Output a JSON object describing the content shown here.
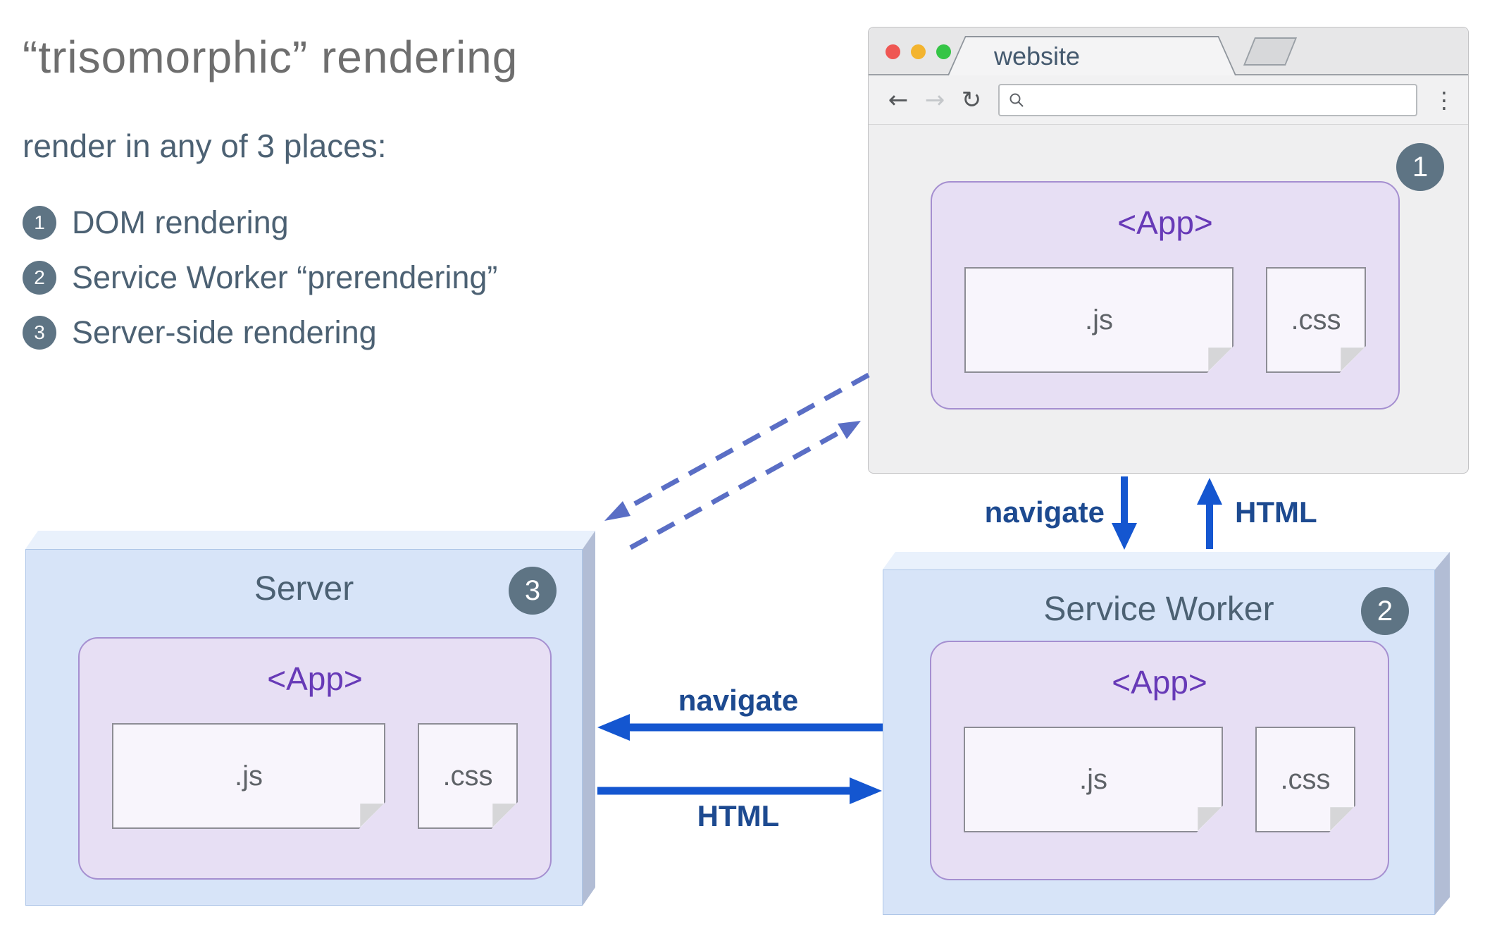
{
  "intro": {
    "title": "“trisomorphic” rendering",
    "subtitle": "render in any of 3 places:",
    "items": [
      {
        "num": "1",
        "label": "DOM rendering"
      },
      {
        "num": "2",
        "label": "Service Worker “prerendering”"
      },
      {
        "num": "3",
        "label": "Server-side rendering"
      }
    ]
  },
  "browser": {
    "tab_title": "website",
    "url_value": "",
    "badge": "1",
    "app": {
      "title": "<App>",
      "js_label": ".js",
      "css_label": ".css"
    }
  },
  "server": {
    "title": "Server",
    "badge": "3",
    "app": {
      "title": "<App>",
      "js_label": ".js",
      "css_label": ".css"
    }
  },
  "service_worker": {
    "title": "Service Worker",
    "badge": "2",
    "app": {
      "title": "<App>",
      "js_label": ".js",
      "css_label": ".css"
    }
  },
  "labels": {
    "navigate_vertical": "navigate",
    "html_vertical": "HTML",
    "navigate_horizontal": "navigate",
    "html_horizontal": "HTML"
  },
  "icons": {
    "back": "←",
    "forward": "→",
    "reload": "↻",
    "menu_dots": "⋮"
  },
  "colors": {
    "arrow_blue": "#1456d0",
    "dashed_indigo": "#5a6ec5",
    "badge_slate": "#5e7484",
    "app_purple": "#673ab7",
    "box_blue": "#d7e4f8",
    "lavender": "#e7dff4"
  }
}
